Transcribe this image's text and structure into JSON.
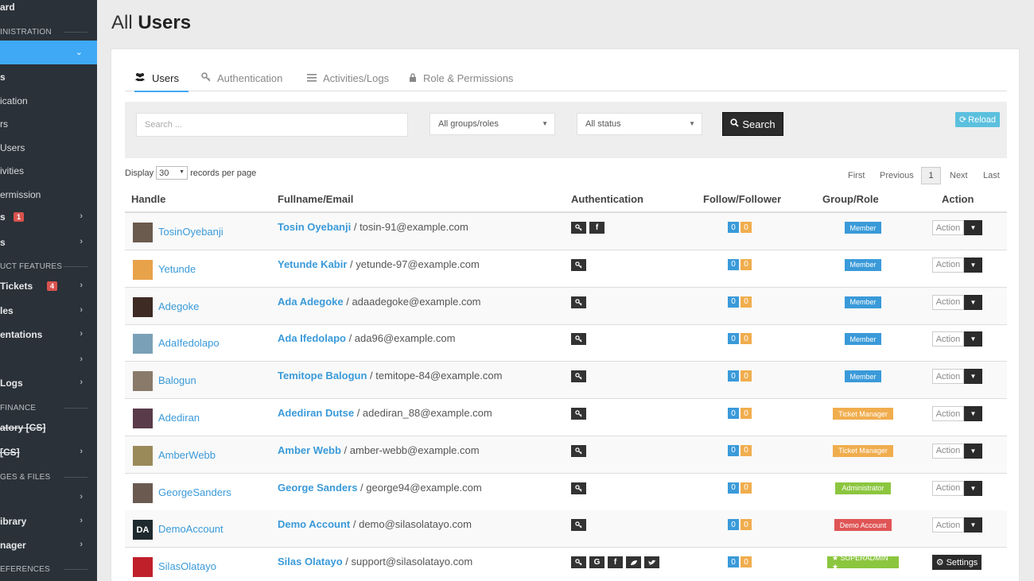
{
  "page": {
    "title_light": "All",
    "title_bold": "Users"
  },
  "sidebar": {
    "items": [
      {
        "label": "ard",
        "kind": "main"
      },
      {
        "label": "INISTRATION",
        "kind": "head"
      },
      {
        "label": "",
        "kind": "active"
      },
      {
        "label": "s",
        "kind": "main"
      },
      {
        "label": "ication",
        "kind": "sub"
      },
      {
        "label": "rs",
        "kind": "sub"
      },
      {
        "label": "Users",
        "kind": "sub"
      },
      {
        "label": "ivities",
        "kind": "sub"
      },
      {
        "label": "ermission",
        "kind": "sub"
      },
      {
        "label": "s",
        "kind": "main",
        "badge": "1"
      },
      {
        "label": "s",
        "kind": "main"
      },
      {
        "label": "UCT FEATURES",
        "kind": "head"
      },
      {
        "label": "Tickets",
        "kind": "main",
        "badge": "4"
      },
      {
        "label": "les",
        "kind": "main"
      },
      {
        "label": "entations",
        "kind": "main"
      },
      {
        "label": "",
        "kind": "main"
      },
      {
        "label": "Logs",
        "kind": "main"
      },
      {
        "label": "FINANCE",
        "kind": "head"
      },
      {
        "label": "atory [CS]",
        "kind": "struck"
      },
      {
        "label": "[CS]",
        "kind": "struck"
      },
      {
        "label": "GES & FILES",
        "kind": "head"
      },
      {
        "label": "",
        "kind": "main"
      },
      {
        "label": "ibrary",
        "kind": "main"
      },
      {
        "label": "nager",
        "kind": "main"
      },
      {
        "label": "EFERENCES",
        "kind": "head"
      }
    ]
  },
  "tabs": [
    {
      "label": "Users",
      "icon": "users-icon",
      "active": true
    },
    {
      "label": "Authentication",
      "icon": "key-icon"
    },
    {
      "label": "Activities/Logs",
      "icon": "list-icon"
    },
    {
      "label": "Role & Permissions",
      "icon": "lock-icon"
    }
  ],
  "filters": {
    "search_placeholder": "Search ...",
    "groups_value": "All groups/roles",
    "status_value": "All status",
    "search_label": "Search",
    "reload_label": "Reload"
  },
  "display": {
    "prefix": "Display",
    "value": "30",
    "suffix": "records per page"
  },
  "pagination": {
    "first": "First",
    "previous": "Previous",
    "current": "1",
    "next": "Next",
    "last": "Last"
  },
  "columns": [
    "Handle",
    "Fullname/Email",
    "Authentication",
    "Follow/Follower",
    "Group/Role",
    "Action"
  ],
  "users": [
    {
      "handle": "TosinOyebanji",
      "name": "Tosin Oyebanji",
      "email": "tosin-91@example.com",
      "auth": [
        "key",
        "f"
      ],
      "follow": "0",
      "follower": "0",
      "role": "Member",
      "role_color": "#3a9ad9",
      "action": "Action"
    },
    {
      "handle": "Yetunde",
      "name": "Yetunde Kabir",
      "email": "yetunde-97@example.com",
      "auth": [
        "key"
      ],
      "follow": "0",
      "follower": "0",
      "role": "Member",
      "role_color": "#3a9ad9",
      "action": "Action"
    },
    {
      "handle": "Adegoke",
      "name": "Ada Adegoke",
      "email": "adaadegoke@example.com",
      "auth": [
        "key"
      ],
      "follow": "0",
      "follower": "0",
      "role": "Member",
      "role_color": "#3a9ad9",
      "action": "Action"
    },
    {
      "handle": "AdaIfedolapo",
      "name": "Ada Ifedolapo",
      "email": "ada96@example.com",
      "auth": [
        "key"
      ],
      "follow": "0",
      "follower": "0",
      "role": "Member",
      "role_color": "#3a9ad9",
      "action": "Action"
    },
    {
      "handle": "Balogun",
      "name": "Temitope Balogun",
      "email": "temitope-84@example.com",
      "auth": [
        "key"
      ],
      "follow": "0",
      "follower": "0",
      "role": "Member",
      "role_color": "#3a9ad9",
      "action": "Action"
    },
    {
      "handle": "Adediran",
      "name": "Adediran Dutse",
      "email": "adediran_88@example.com",
      "auth": [
        "key"
      ],
      "follow": "0",
      "follower": "0",
      "role": "Ticket Manager",
      "role_color": "#f0ad4e",
      "action": "Action"
    },
    {
      "handle": "AmberWebb",
      "name": "Amber Webb",
      "email": "amber-webb@example.com",
      "auth": [
        "key"
      ],
      "follow": "0",
      "follower": "0",
      "role": "Ticket Manager",
      "role_color": "#f0ad4e",
      "action": "Action"
    },
    {
      "handle": "GeorgeSanders",
      "name": "George Sanders",
      "email": "george94@example.com",
      "auth": [
        "key"
      ],
      "follow": "0",
      "follower": "0",
      "role": "Administrator",
      "role_color": "#8cc63f",
      "action": "Action"
    },
    {
      "handle": "DemoAccount",
      "name": "Demo Account",
      "email": "demo@silasolatayo.com",
      "auth": [
        "key"
      ],
      "follow": "0",
      "follower": "0",
      "role": "Demo Account",
      "role_color": "#e05555",
      "action": "Action",
      "initials": "DA"
    },
    {
      "handle": "SilasOlatayo",
      "name": "Silas Olatayo",
      "email": "support@silasolatayo.com",
      "auth": [
        "key",
        "G",
        "f",
        "leaf",
        "t"
      ],
      "follow": "0",
      "follower": "0",
      "role": "★ SUPERADMIN ★",
      "role_color": "#8cc63f",
      "action": "Settings"
    }
  ]
}
